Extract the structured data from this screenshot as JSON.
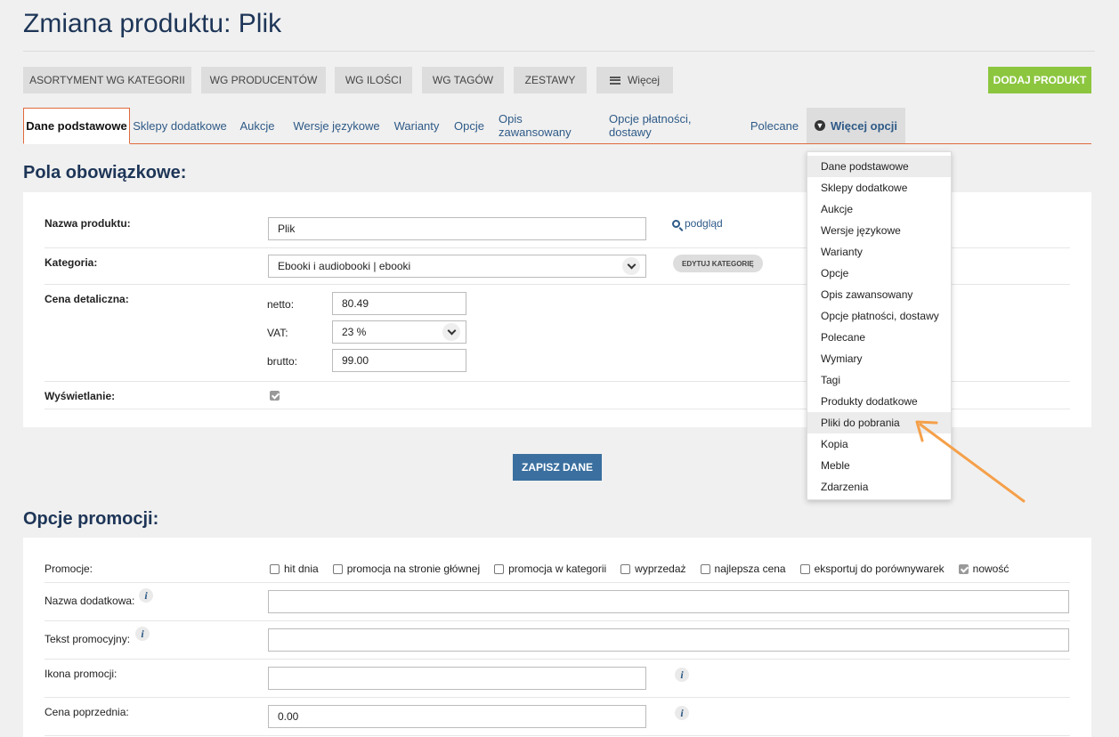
{
  "page": {
    "title": "Zmiana produktu: Plik"
  },
  "top_buttons": [
    "ASORTYMENT WG KATEGORII",
    "WG PRODUCENTÓW",
    "WG ILOŚCI",
    "WG TAGÓW",
    "ZESTAWY"
  ],
  "more_button": "Więcej",
  "add_button": "DODAJ PRODUKT",
  "tabs": [
    "Dane podstawowe",
    "Sklepy dodatkowe",
    "Aukcje",
    "Wersje językowe",
    "Warianty",
    "Opcje",
    "Opis zawansowany",
    "Opcje płatności, dostawy",
    "Polecane"
  ],
  "more_options_tab": "Więcej opcji",
  "required": {
    "title": "Pola obowiązkowe:",
    "name_label": "Nazwa produktu:",
    "name_value": "Plik",
    "preview_link": "podgląd",
    "category_label": "Kategoria:",
    "category_value": "Ebooki i audiobooki | ebooki",
    "edit_category": "EDYTUJ KATEGORIĘ",
    "price_label": "Cena detaliczna:",
    "netto_label": "netto:",
    "netto_value": "80.49",
    "vat_label": "VAT:",
    "vat_value": "23 %",
    "brutto_label": "brutto:",
    "brutto_value": "99.00",
    "display_label": "Wyświetlanie:",
    "display_checked": true
  },
  "save_button": "ZAPISZ DANE",
  "promo": {
    "title": "Opcje promocji:",
    "promo_label": "Promocje:",
    "options": [
      {
        "label": "hit dnia",
        "checked": false
      },
      {
        "label": "promocja na stronie głównej",
        "checked": false
      },
      {
        "label": "promocja w kategorii",
        "checked": false
      },
      {
        "label": "wyprzedaż",
        "checked": false
      },
      {
        "label": "najlepsza cena",
        "checked": false
      },
      {
        "label": "eksportuj do porównywarek",
        "checked": false
      },
      {
        "label": "nowość",
        "checked": true
      }
    ],
    "extra_name_label": "Nazwa dodatkowa:",
    "promo_text_label": "Tekst promocyjny:",
    "promo_icon_label": "Ikona promocji:",
    "prev_price_label": "Cena poprzednia:",
    "prev_price_value": "0.00"
  },
  "dropdown": {
    "items": [
      "Dane podstawowe",
      "Sklepy dodatkowe",
      "Aukcje",
      "Wersje językowe",
      "Warianty",
      "Opcje",
      "Opis zawansowany",
      "Opcje płatności, dostawy",
      "Polecane",
      "Wymiary",
      "Tagi",
      "Produkty dodatkowe",
      "Pliki do pobrania",
      "Kopia",
      "Meble",
      "Zdarzenia"
    ],
    "highlighted": [
      "Dane podstawowe",
      "Pliki do pobrania"
    ]
  },
  "colors": {
    "accent": "#e06a3c",
    "title": "#1d3557",
    "link": "#2e5a87",
    "add": "#8cc63f",
    "save": "#3a6f9f",
    "arrow": "#f5a04a"
  }
}
